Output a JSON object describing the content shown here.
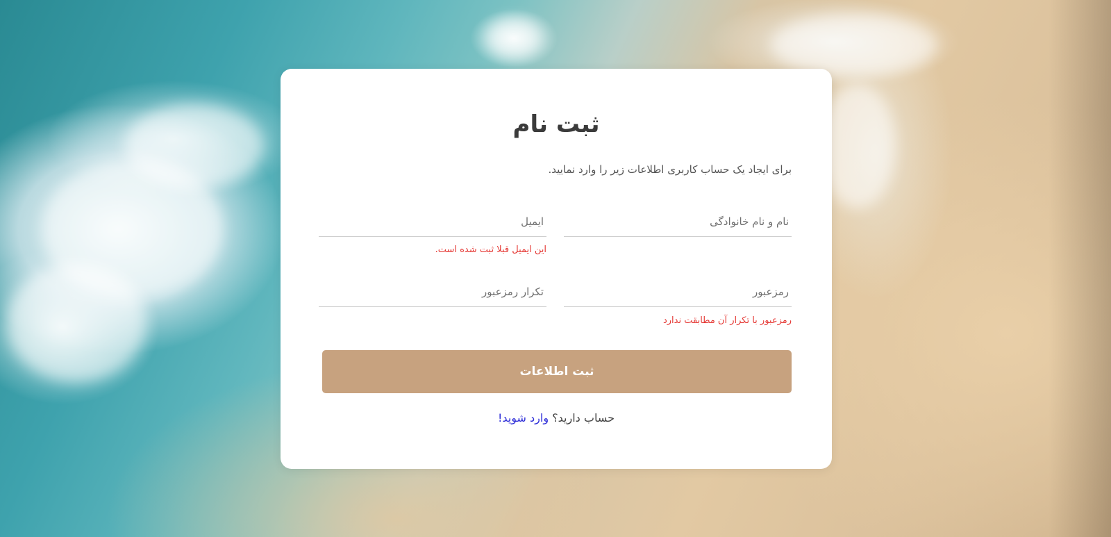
{
  "form": {
    "title": "ثبت نام",
    "subtitle": "برای ایجاد یک حساب کاربری اطلاعات زیر را وارد نمایید.",
    "fields": {
      "full_name": {
        "placeholder": "نام و نام خانوادگی",
        "value": ""
      },
      "email": {
        "placeholder": "ایمیل",
        "value": "",
        "error": "این ایمیل قبلا ثبت شده است."
      },
      "password": {
        "placeholder": "رمزعبور",
        "value": "",
        "error": "رمزعبور با تکرار آن مطابقت ندارد"
      },
      "password_confirm": {
        "placeholder": "تکرار رمزعبور",
        "value": ""
      }
    },
    "submit_label": "ثبت اطلاعات",
    "footer": {
      "question": "حساب دارید؟",
      "login_link": "وارد شوید!"
    }
  },
  "colors": {
    "button": "#c7a27f",
    "error": "#e53935",
    "link": "#2f2fd8"
  }
}
